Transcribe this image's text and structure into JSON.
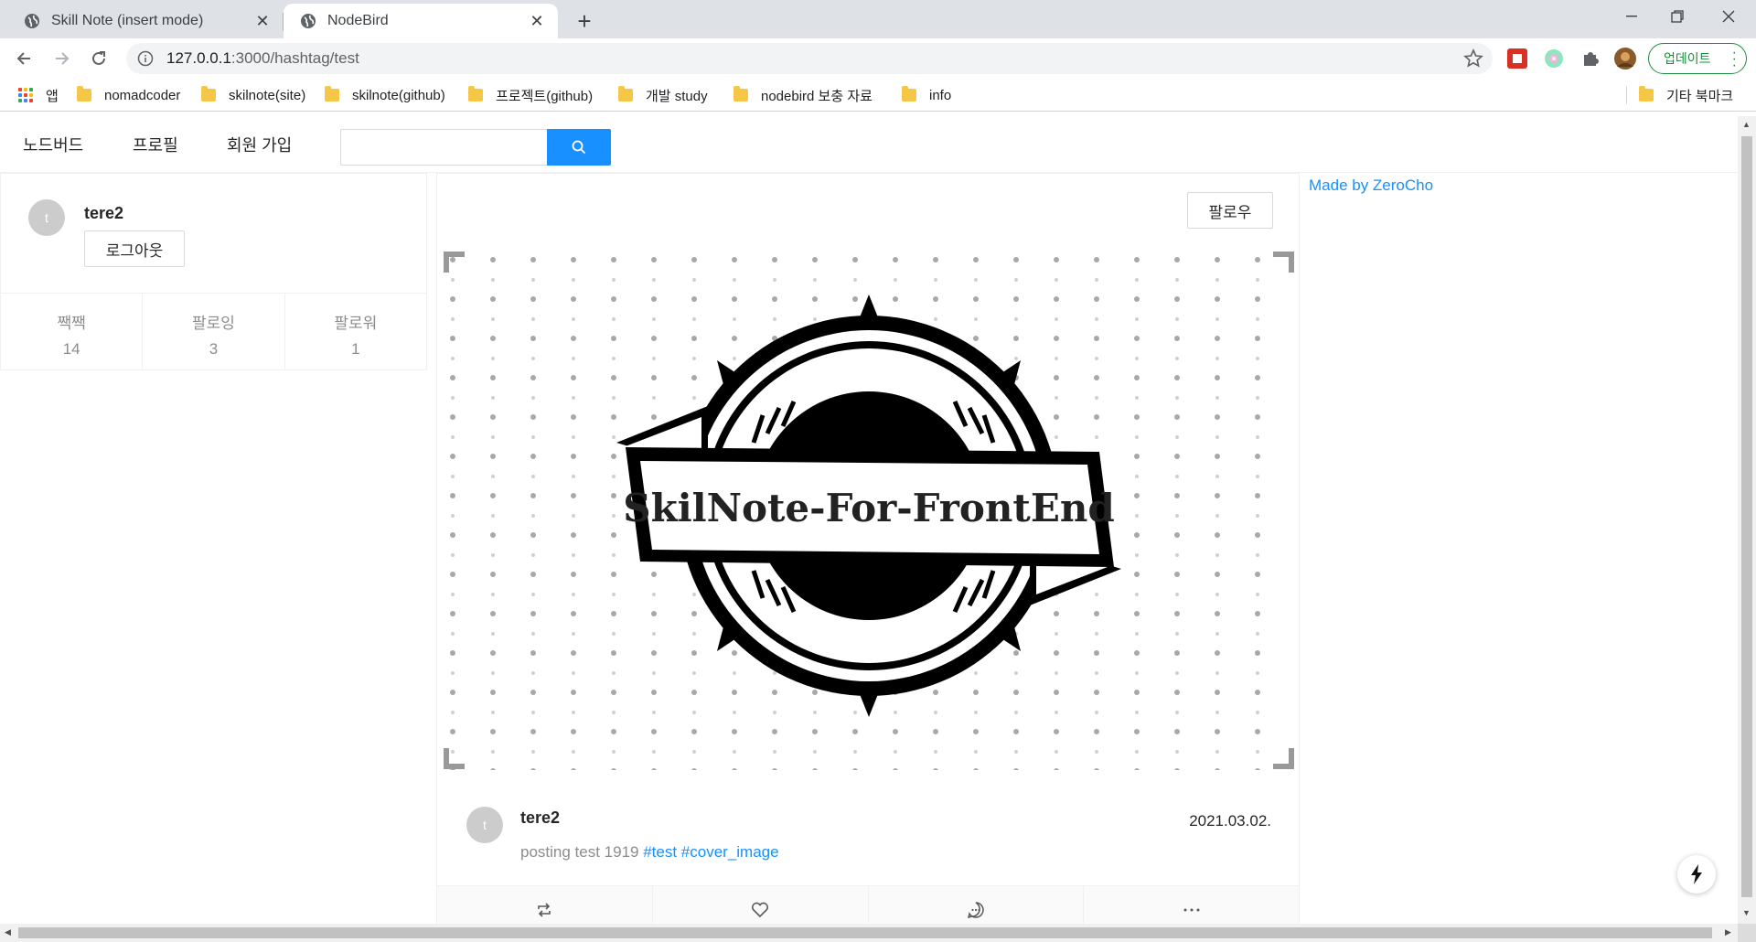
{
  "browser": {
    "tabs": [
      {
        "title": "Skill Note (insert mode)",
        "active": false
      },
      {
        "title": "NodeBird",
        "active": true
      }
    ],
    "url_host": "127.0.0.1",
    "url_rest": ":3000/hashtag/test",
    "update_label": "업데이트",
    "bookmarks": [
      {
        "label": "앱",
        "icon": "apps-grid-icon"
      },
      {
        "label": "nomadcoder",
        "icon": "folder-icon"
      },
      {
        "label": "skilnote(site)",
        "icon": "folder-icon"
      },
      {
        "label": "skilnote(github)",
        "icon": "folder-icon"
      },
      {
        "label": "프로젝트(github)",
        "icon": "folder-icon"
      },
      {
        "label": "개발 study",
        "icon": "folder-icon"
      },
      {
        "label": "nodebird 보충 자료",
        "icon": "folder-icon"
      },
      {
        "label": "info",
        "icon": "folder-icon"
      }
    ],
    "other_bookmarks": "기타 북마크"
  },
  "menu": {
    "home": "노드버드",
    "profile": "프로필",
    "signup": "회원 가입",
    "search_placeholder": ""
  },
  "user_card": {
    "avatar_letter": "t",
    "nickname": "tere2",
    "logout_label": "로그아웃",
    "stats": [
      {
        "label": "짹짹",
        "value": "14"
      },
      {
        "label": "팔로잉",
        "value": "3"
      },
      {
        "label": "팔로워",
        "value": "1"
      }
    ]
  },
  "post": {
    "follow_label": "팔로우",
    "cover_text": "SkilNote-For-FrontEnd",
    "avatar_letter": "t",
    "author": "tere2",
    "date": "2021.03.02.",
    "content_text": "posting test 1919",
    "hashtags": [
      "#test",
      "#cover_image"
    ],
    "actions": [
      "retweet-icon",
      "heart-icon",
      "message-icon",
      "ellipsis-icon"
    ]
  },
  "sidebar_right": {
    "madeby": "Made by ZeroCho"
  },
  "colors": {
    "primary": "#1890ff",
    "chrome_bg": "#dee1e6",
    "update_green": "#1e8e3e",
    "folder_yellow": "#f6c746"
  }
}
